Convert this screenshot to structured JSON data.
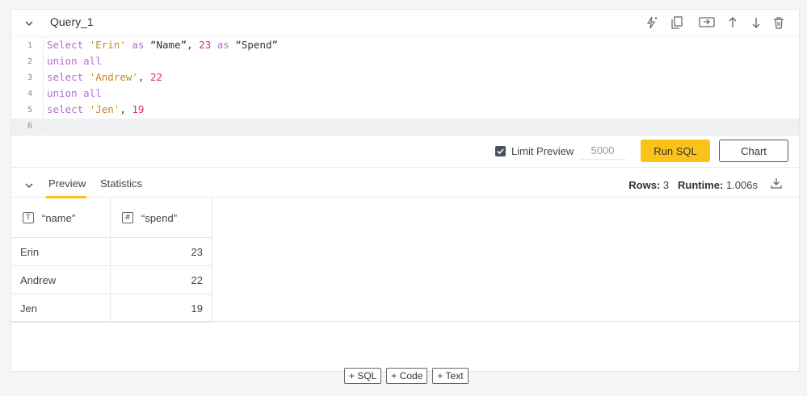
{
  "cell": {
    "title": "Query_1"
  },
  "editor": {
    "line_numbers": [
      "1",
      "2",
      "3",
      "4",
      "5",
      "6"
    ],
    "lines": [
      [
        {
          "t": "kw",
          "v": "Select"
        },
        {
          "t": "p",
          "v": " "
        },
        {
          "t": "str",
          "v": "'Erin'"
        },
        {
          "t": "p",
          "v": " "
        },
        {
          "t": "kw",
          "v": "as"
        },
        {
          "t": "p",
          "v": " “Name”, "
        },
        {
          "t": "num",
          "v": "23"
        },
        {
          "t": "p",
          "v": " "
        },
        {
          "t": "kw",
          "v": "as"
        },
        {
          "t": "p",
          "v": " “Spend”"
        }
      ],
      [
        {
          "t": "kw",
          "v": "union all"
        }
      ],
      [
        {
          "t": "kw",
          "v": "select"
        },
        {
          "t": "p",
          "v": " "
        },
        {
          "t": "str",
          "v": "'Andrew'"
        },
        {
          "t": "p",
          "v": ", "
        },
        {
          "t": "num",
          "v": "22"
        }
      ],
      [
        {
          "t": "kw",
          "v": "union all"
        }
      ],
      [
        {
          "t": "kw",
          "v": "select"
        },
        {
          "t": "p",
          "v": " "
        },
        {
          "t": "str",
          "v": "'Jen'"
        },
        {
          "t": "p",
          "v": ", "
        },
        {
          "t": "num",
          "v": "19"
        }
      ],
      []
    ]
  },
  "runbar": {
    "limit_label": "Limit Preview",
    "limit_checked": true,
    "limit_value": "5000",
    "run_label": "Run SQL",
    "chart_label": "Chart"
  },
  "results": {
    "tabs": [
      "Preview",
      "Statistics"
    ],
    "rows_label": "Rows:",
    "rows_value": "3",
    "runtime_label": "Runtime:",
    "runtime_value": "1.006s",
    "columns": [
      {
        "label": "“name”",
        "type_icon": "T"
      },
      {
        "label": "“spend”",
        "type_icon": "#"
      }
    ],
    "rows": [
      [
        "Erin",
        "23"
      ],
      [
        "Andrew",
        "22"
      ],
      [
        "Jen",
        "19"
      ]
    ]
  },
  "add_buttons": [
    "+ SQL",
    "+ Code",
    "+ Text"
  ],
  "colors": {
    "accent": "#fbc21a",
    "keyword": "#b46bd6",
    "string": "#c4892b",
    "number": "#d8336e"
  }
}
